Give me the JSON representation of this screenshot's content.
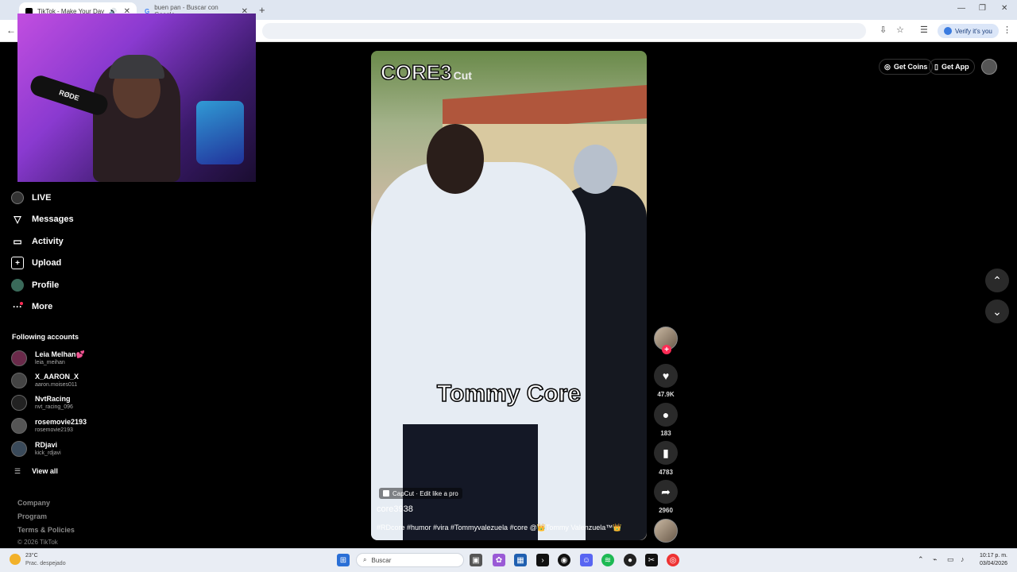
{
  "browser": {
    "tabs": [
      {
        "title": "TikTok - Make Your Day",
        "active": true
      },
      {
        "title": "buen pan - Buscar con Google",
        "active": false
      }
    ],
    "new_tab": "+",
    "close": "✕",
    "verify_label": "Verify it's you",
    "back": "←"
  },
  "webcam": {
    "mic_brand": "RØDE"
  },
  "sidebar": {
    "items": [
      {
        "label": "LIVE",
        "icon": "live-icon"
      },
      {
        "label": "Messages",
        "icon": "send-icon"
      },
      {
        "label": "Activity",
        "icon": "activity-icon"
      },
      {
        "label": "Upload",
        "icon": "upload-icon"
      },
      {
        "label": "Profile",
        "icon": "profile-icon"
      },
      {
        "label": "More",
        "icon": "more-icon"
      }
    ],
    "following_title": "Following accounts",
    "accounts": [
      {
        "name": "Leia Melhan💕",
        "handle": "leia_meihan"
      },
      {
        "name": "X_AARON_X",
        "handle": "aaron.moises011"
      },
      {
        "name": "NvtRacing",
        "handle": "nvt_racing_096"
      },
      {
        "name": "rosemovie2193",
        "handle": "rosemovie2193"
      },
      {
        "name": "RDjavi",
        "handle": "kick_rdjavi"
      }
    ],
    "view_all": "View all",
    "footer": [
      "Company",
      "Program",
      "Terms & Policies"
    ],
    "copyright": "© 2026 TikTok"
  },
  "topbar": {
    "get_coins": "Get Coins",
    "get_app": "Get App"
  },
  "video": {
    "brand": "CORE3",
    "brand_suffix": "Cut",
    "caption": "Tommy Core",
    "capcut_label": "CapCut · Edit like a pro",
    "author": "core3938",
    "description": "#RDcore #humor #vira #Tommyvalezuela #core @👑Tommy Valenzuela™👑"
  },
  "actions": {
    "likes": "47.9K",
    "comments": "183",
    "saves": "4783",
    "shares": "2960"
  },
  "taskbar": {
    "temp": "23°C",
    "weather": "Prac. despejado",
    "search": "Buscar",
    "time": "10:17 p. m.",
    "date": "03/04/2026"
  }
}
